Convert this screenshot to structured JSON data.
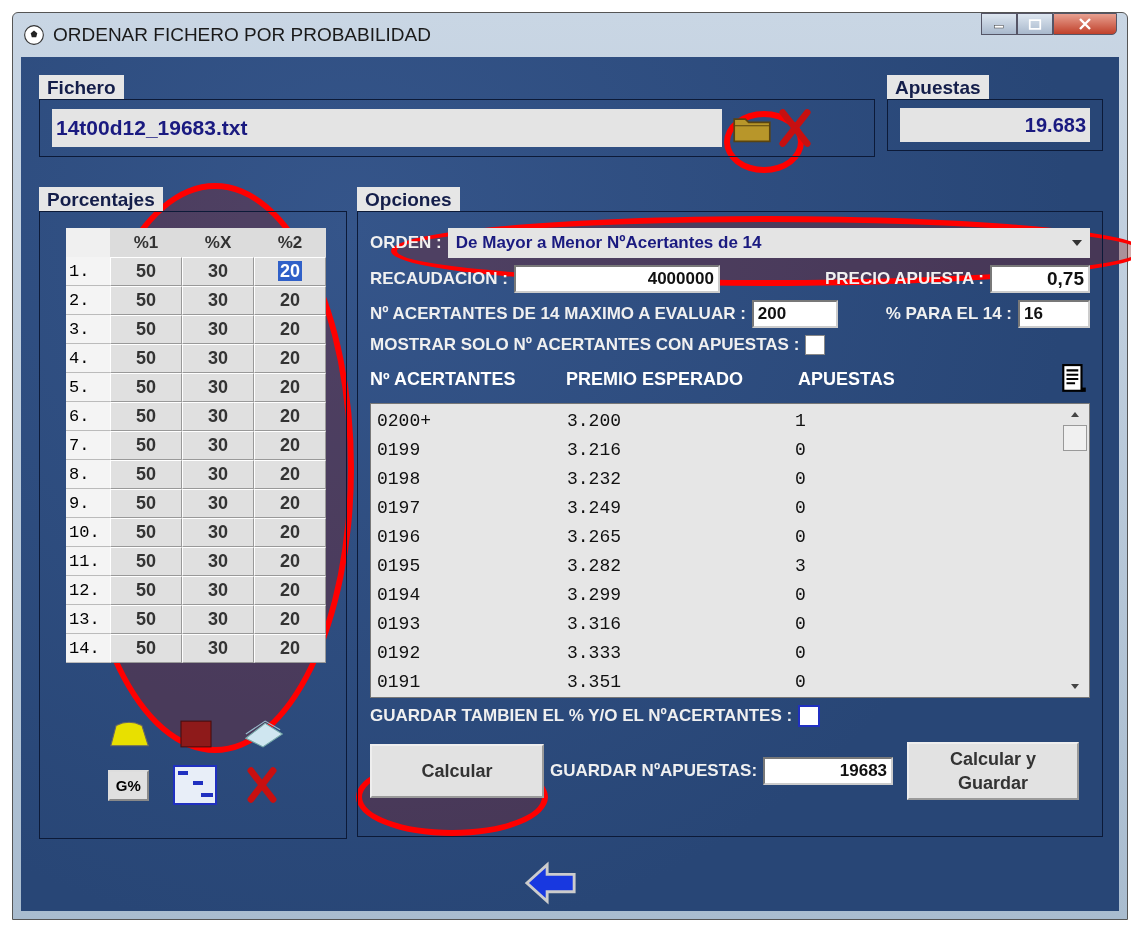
{
  "window": {
    "title": "ORDENAR FICHERO POR PROBABILIDAD"
  },
  "fichero": {
    "label": "Fichero",
    "value": "14t00d12_19683.txt"
  },
  "apuestas": {
    "label": "Apuestas",
    "value": "19.683"
  },
  "porcentajes": {
    "label": "Porcentajes",
    "columns": [
      "%1",
      "%X",
      "%2"
    ],
    "rows": [
      {
        "label": "1.",
        "cells": [
          {
            "text": "50",
            "selected": false
          },
          {
            "text": "30",
            "selected": false
          },
          {
            "text": "20",
            "selected": true
          }
        ]
      },
      {
        "label": "2.",
        "cells": [
          {
            "text": "50",
            "selected": false
          },
          {
            "text": "30",
            "selected": false
          },
          {
            "text": "20",
            "selected": false
          }
        ]
      },
      {
        "label": "3.",
        "cells": [
          {
            "text": "50",
            "selected": false
          },
          {
            "text": "30",
            "selected": false
          },
          {
            "text": "20",
            "selected": false
          }
        ]
      },
      {
        "label": "4.",
        "cells": [
          {
            "text": "50",
            "selected": false
          },
          {
            "text": "30",
            "selected": false
          },
          {
            "text": "20",
            "selected": false
          }
        ]
      },
      {
        "label": "5.",
        "cells": [
          {
            "text": "50",
            "selected": false
          },
          {
            "text": "30",
            "selected": false
          },
          {
            "text": "20",
            "selected": false
          }
        ]
      },
      {
        "label": "6.",
        "cells": [
          {
            "text": "50",
            "selected": false
          },
          {
            "text": "30",
            "selected": false
          },
          {
            "text": "20",
            "selected": false
          }
        ]
      },
      {
        "label": "7.",
        "cells": [
          {
            "text": "50",
            "selected": false
          },
          {
            "text": "30",
            "selected": false
          },
          {
            "text": "20",
            "selected": false
          }
        ]
      },
      {
        "label": "8.",
        "cells": [
          {
            "text": "50",
            "selected": false
          },
          {
            "text": "30",
            "selected": false
          },
          {
            "text": "20",
            "selected": false
          }
        ]
      },
      {
        "label": "9.",
        "cells": [
          {
            "text": "50",
            "selected": false
          },
          {
            "text": "30",
            "selected": false
          },
          {
            "text": "20",
            "selected": false
          }
        ]
      },
      {
        "label": "10.",
        "cells": [
          {
            "text": "50",
            "selected": false
          },
          {
            "text": "30",
            "selected": false
          },
          {
            "text": "20",
            "selected": false
          }
        ]
      },
      {
        "label": "11.",
        "cells": [
          {
            "text": "50",
            "selected": false
          },
          {
            "text": "30",
            "selected": false
          },
          {
            "text": "20",
            "selected": false
          }
        ]
      },
      {
        "label": "12.",
        "cells": [
          {
            "text": "50",
            "selected": false
          },
          {
            "text": "30",
            "selected": false
          },
          {
            "text": "20",
            "selected": false
          }
        ]
      },
      {
        "label": "13.",
        "cells": [
          {
            "text": "50",
            "selected": false
          },
          {
            "text": "30",
            "selected": false
          },
          {
            "text": "20",
            "selected": false
          }
        ]
      },
      {
        "label": "14.",
        "cells": [
          {
            "text": "50",
            "selected": false
          },
          {
            "text": "30",
            "selected": false
          },
          {
            "text": "20",
            "selected": false
          }
        ]
      }
    ],
    "g_button": "G%"
  },
  "opciones": {
    "label": "Opciones",
    "orden": {
      "label": "ORDEN :",
      "value": "De Mayor a Menor NºAcertantes de 14"
    },
    "recaudacion": {
      "label": "RECAUDACION :",
      "value": "4000000"
    },
    "precio": {
      "label": "PRECIO APUESTA :",
      "value": "0,75"
    },
    "max_acertantes": {
      "label": "Nº ACERTANTES DE 14 MAXIMO A EVALUAR :",
      "value": "200"
    },
    "porcentaje_14": {
      "label": "% PARA EL 14 :",
      "value": "16"
    },
    "mostrar_solo": {
      "label": "MOSTRAR SOLO Nº ACERTANTES CON APUESTAS :",
      "checked": false
    },
    "list": {
      "columns": [
        "Nº ACERTANTES",
        "PREMIO ESPERADO",
        "APUESTAS"
      ],
      "rows": [
        [
          "0200+",
          "3.200",
          "1"
        ],
        [
          "0199",
          "3.216",
          "0"
        ],
        [
          "0198",
          "3.232",
          "0"
        ],
        [
          "0197",
          "3.249",
          "0"
        ],
        [
          "0196",
          "3.265",
          "0"
        ],
        [
          "0195",
          "3.282",
          "3"
        ],
        [
          "0194",
          "3.299",
          "0"
        ],
        [
          "0193",
          "3.316",
          "0"
        ],
        [
          "0192",
          "3.333",
          "0"
        ],
        [
          "0191",
          "3.351",
          "0"
        ]
      ]
    },
    "guardar_tambien": {
      "label": "GUARDAR TAMBIEN EL % Y/O EL NºACERTANTES :",
      "checked": false
    },
    "calcular": "Calcular",
    "guardar_apuestas": {
      "label": "GUARDAR NºAPUESTAS:",
      "value": "19683"
    },
    "calcular_guardar": "Calcular y Guardar"
  }
}
